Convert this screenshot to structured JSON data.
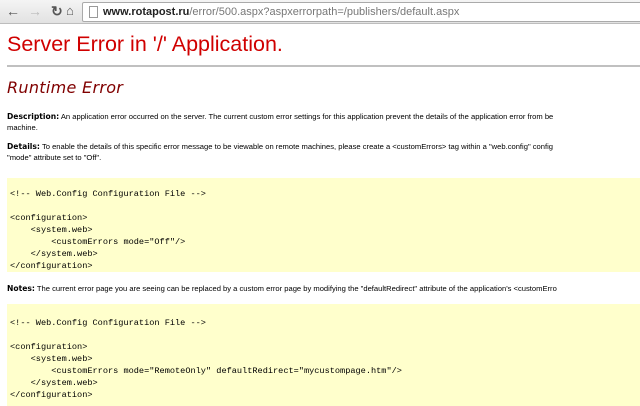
{
  "browser": {
    "url_domain": "www.rotapost.ru",
    "url_path": "/error/500.aspx?aspxerrorpath=/publishers/default.aspx"
  },
  "page": {
    "title": "Server Error in '/' Application.",
    "subtitle": "Runtime Error",
    "description_label": "Description:",
    "description_line1": " An application error occurred on the server. The current custom error settings for this application prevent the details of the application error from be",
    "description_line2": "machine.",
    "details_label": "Details:",
    "details_line1": " To enable the details of this specific error message to be viewable on remote machines, please create a <customErrors> tag within a \"web.config\" config",
    "details_line2": "\"mode\" attribute set to \"Off\".",
    "code1": [
      "<!-- Web.Config Configuration File -->",
      "",
      "<configuration>",
      "    <system.web>",
      "        <customErrors mode=\"Off\"/>",
      "    </system.web>",
      "</configuration>"
    ],
    "notes_label": "Notes:",
    "notes_line1": " The current error page you are seeing can be replaced by a custom error page by modifying the \"defaultRedirect\" attribute of the application's <customErro",
    "code2": [
      "<!-- Web.Config Configuration File -->",
      "",
      "<configuration>",
      "    <system.web>",
      "        <customErrors mode=\"RemoteOnly\" defaultRedirect=\"mycustompage.htm\"/>",
      "    </system.web>",
      "</configuration>"
    ]
  }
}
